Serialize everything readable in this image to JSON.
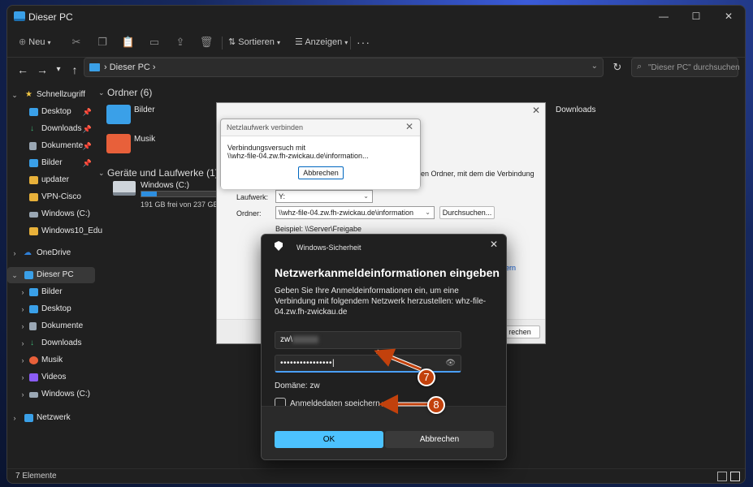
{
  "window": {
    "title": "Dieser PC"
  },
  "toolbar": {
    "new_label": "Neu",
    "sort_label": "Sortieren",
    "view_label": "Anzeigen",
    "more_label": "···"
  },
  "address": {
    "crumb": "Dieser PC"
  },
  "search": {
    "placeholder": "\"Dieser PC\" durchsuchen"
  },
  "sidebar": {
    "items": [
      {
        "label": "Schnellzugriff",
        "color": "#f2c744"
      },
      {
        "label": "Desktop",
        "color": "#3aa0e8"
      },
      {
        "label": "Downloads",
        "color": "#3bb273"
      },
      {
        "label": "Dokumente",
        "color": "#9aa7b4"
      },
      {
        "label": "Bilder",
        "color": "#3aa0e8"
      },
      {
        "label": "updater",
        "color": "#e8b13a"
      },
      {
        "label": "VPN-Cisco",
        "color": "#e8b13a"
      },
      {
        "label": "Windows (C:)",
        "color": "#9aa7b4"
      },
      {
        "label": "Windows10_Edu",
        "color": "#e8b13a"
      },
      {
        "label": "OneDrive",
        "color": "#2f7fd6"
      },
      {
        "label": "Dieser PC",
        "color": "#3aa0e8"
      },
      {
        "label": "Bilder",
        "color": "#3aa0e8"
      },
      {
        "label": "Desktop",
        "color": "#3aa0e8"
      },
      {
        "label": "Dokumente",
        "color": "#9aa7b4"
      },
      {
        "label": "Downloads",
        "color": "#3bb273"
      },
      {
        "label": "Musik",
        "color": "#e8603a"
      },
      {
        "label": "Videos",
        "color": "#8b5cf6"
      },
      {
        "label": "Windows (C:)",
        "color": "#9aa7b4"
      },
      {
        "label": "Netzwerk",
        "color": "#3aa0e8"
      }
    ]
  },
  "content": {
    "folders_header": "Ordner (6)",
    "folders": [
      {
        "name": "Bilder",
        "color": "#3aa0e8"
      },
      {
        "name": "Musik",
        "color": "#e8603a"
      },
      {
        "name": "Downloads",
        "color": "#3bb273"
      }
    ],
    "drives_header": "Geräte und Laufwerke (1)",
    "drive": {
      "name": "Windows (C:)",
      "free": "191 GB frei von 237 GB",
      "used_fraction": 0.19
    }
  },
  "status": {
    "items": "7 Elemente"
  },
  "map_dialog": {
    "partial_desc": "den Ordner, mit dem die Verbindung",
    "drive_label": "Laufwerk:",
    "drive_value": "Y:",
    "folder_label": "Ordner:",
    "folder_value": "\\\\whz-file-04.zw.fh-zwickau.de\\information",
    "browse_label": "Durchsuchen...",
    "example": "Beispiel: \\\\Server\\Freigabe",
    "link_fragment": "ern",
    "cancel_fragment": "rechen"
  },
  "conn_dialog": {
    "title": "Netzlaufwerk verbinden",
    "line1": "Verbindungsversuch mit",
    "line2": "\\\\whz-file-04.zw.fh-zwickau.de\\information...",
    "cancel": "Abbrechen"
  },
  "security": {
    "app_title": "Windows-Sicherheit",
    "heading": "Netzwerkanmeldeinformationen eingeben",
    "description": "Geben Sie Ihre Anmeldeinformationen ein, um eine Verbindung mit folgendem Netzwerk herzustellen: whz-file-04.zw.fh-zwickau.de",
    "username_prefix": "zw\\",
    "password_mask": "••••••••••••••••",
    "domain": "Domäne: zw",
    "remember_label": "Anmeldedaten speichern",
    "ok": "OK",
    "cancel": "Abbrechen"
  },
  "annotations": {
    "step7": "7",
    "step8": "8",
    "accent": "#c2410c"
  }
}
